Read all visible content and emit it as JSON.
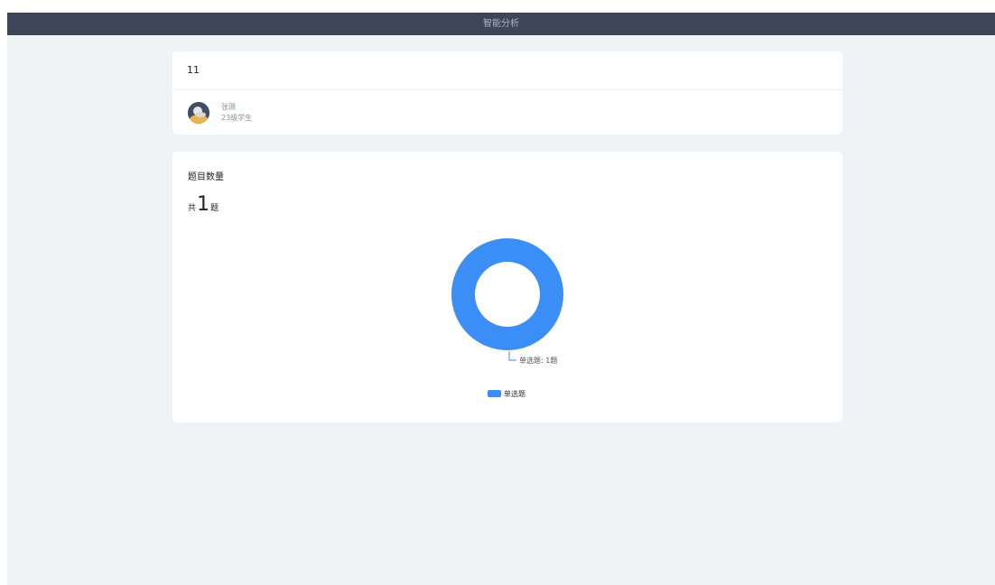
{
  "header": {
    "title": "智能分析"
  },
  "info": {
    "title": "11",
    "user": {
      "name": "张璟",
      "grade": "23级学生"
    }
  },
  "summary": {
    "section_title": "题目数量",
    "total_prefix": "共",
    "total": "1",
    "total_suffix": "题"
  },
  "colors": {
    "series": "#3a8ef6",
    "topbar": "#3c4657",
    "background": "#f0f3f6"
  },
  "chart_data": {
    "type": "pie",
    "donut": true,
    "categories": [
      "单选题"
    ],
    "values": [
      1
    ],
    "labels": [
      "单选题: 1题"
    ],
    "legend": [
      "单选题"
    ],
    "legend_position": "bottom"
  }
}
